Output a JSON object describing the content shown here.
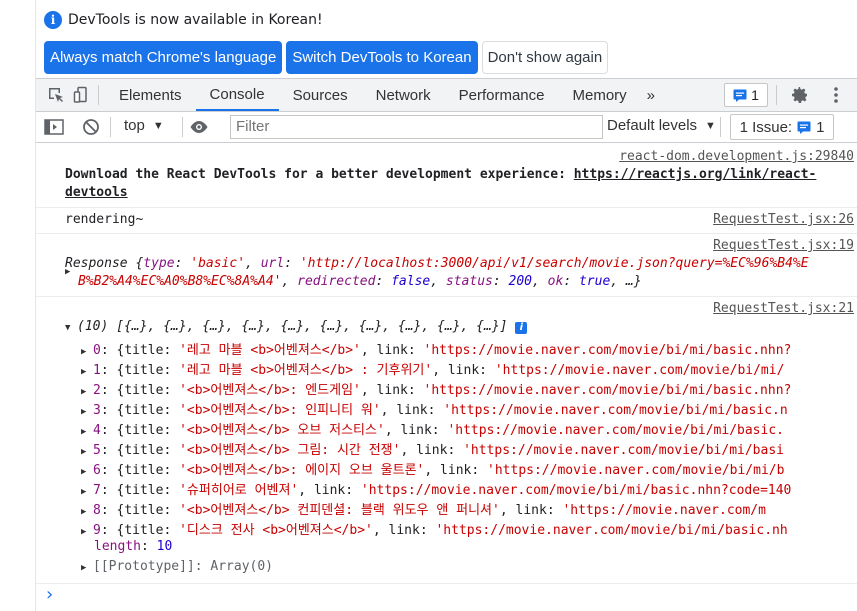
{
  "infobar": {
    "message": "DevTools is now available in Korean!",
    "buttons": [
      "Always match Chrome's language",
      "Switch DevTools to Korean",
      "Don't show again"
    ]
  },
  "tabs": [
    "Elements",
    "Console",
    "Sources",
    "Network",
    "Performance",
    "Memory"
  ],
  "active_tab": "Console",
  "more_tabs": "»",
  "messages_count": "1",
  "toolbar": {
    "context": "top",
    "filter_placeholder": "Filter",
    "levels": "Default levels",
    "issues_label": "1 Issue:",
    "issues_count": "1"
  },
  "console": {
    "msg1": {
      "source": "react-dom.development.js:29840",
      "text": "Download the React DevTools for a better development experience: ",
      "link1": "https://reactjs.org/link/react-",
      "link2": "devtools"
    },
    "msg2": {
      "source": "RequestTest.jsx:26",
      "text": "rendering~"
    },
    "msg3": {
      "source": "RequestTest.jsx:19",
      "line1_a": "Response {",
      "line1_type_key": "type",
      "line1_type_val": "'basic'",
      "line1_url_key": "url",
      "line1_url_val": "'http://localhost:3000/api/v1/search/movie.json?query=%EC%96%B4%E",
      "line2_cont": "B%B2%A4%EC%A0%B8%EC%8A%A4'",
      "line2_redirected_key": "redirected",
      "line2_redirected_val": "false",
      "line2_status_key": "status",
      "line2_status_val": "200",
      "line2_ok_key": "ok",
      "line2_ok_val": "true",
      "line2_end": ", …}"
    },
    "msg4": {
      "source": "RequestTest.jsx:21",
      "summary": "(10) [{…}, {…}, {…}, {…}, {…}, {…}, {…}, {…}, {…}, {…}]",
      "items": [
        {
          "idx": "0",
          "title": "'레고 마블 <b>어벤져스</b>'",
          "link": "'https://movie.naver.com/movie/bi/mi/basic.nhn?"
        },
        {
          "idx": "1",
          "title": "'레고 마블 <b>어벤져스</b> : 기후위기'",
          "link": "'https://movie.naver.com/movie/bi/mi/"
        },
        {
          "idx": "2",
          "title": "'<b>어벤져스</b>: 엔드게임'",
          "link": "'https://movie.naver.com/movie/bi/mi/basic.nhn?"
        },
        {
          "idx": "3",
          "title": "'<b>어벤져스</b>: 인피니티 워'",
          "link": "'https://movie.naver.com/movie/bi/mi/basic.n"
        },
        {
          "idx": "4",
          "title": "'<b>어벤져스</b> 오브 저스티스'",
          "link": "'https://movie.naver.com/movie/bi/mi/basic."
        },
        {
          "idx": "5",
          "title": "'<b>어벤져스</b> 그림: 시간 전쟁'",
          "link": "'https://movie.naver.com/movie/bi/mi/basi"
        },
        {
          "idx": "6",
          "title": "'<b>어벤져스</b>: 에이지 오브 울트론'",
          "link": "'https://movie.naver.com/movie/bi/mi/b"
        },
        {
          "idx": "7",
          "title": "'슈퍼히어로 어벤져'",
          "link": "'https://movie.naver.com/movie/bi/mi/basic.nhn?code=140"
        },
        {
          "idx": "8",
          "title": "'<b>어벤져스</b> 컨피덴셜: 블랙 위도우 앤 퍼니셔'",
          "link": "'https://movie.naver.com/m"
        },
        {
          "idx": "9",
          "title": "'디스크 전사 <b>어벤져스</b>'",
          "link": "'https://movie.naver.com/movie/bi/mi/basic.nh"
        }
      ],
      "length_key": "length",
      "length_val": "10",
      "prototype": "[[Prototype]]: Array(0)"
    }
  },
  "prompt": "›"
}
